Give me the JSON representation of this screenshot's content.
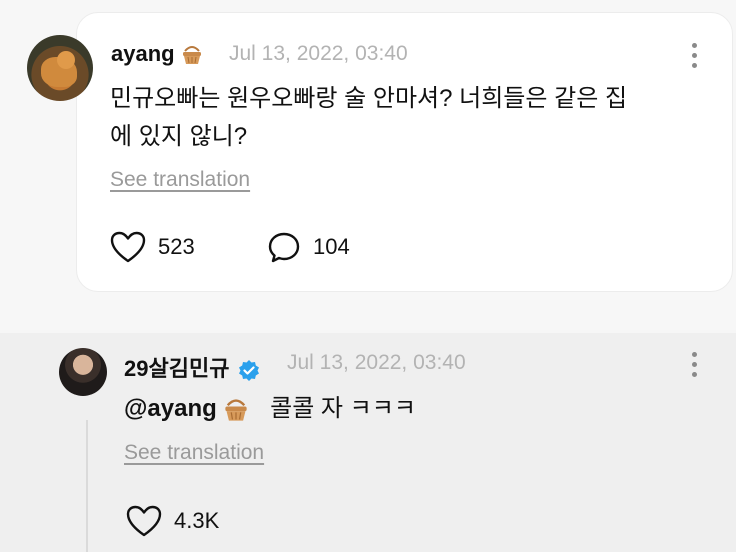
{
  "fan_comment": {
    "username": "ayang",
    "timestamp": "Jul 13, 2022, 03:40",
    "text_line1": "민규오빠는 원우오빠랑 술 안마셔? 너희들은 같은 집",
    "text_line2": "에 있지 않니?",
    "see_translation": "See translation",
    "likes": "523",
    "replies": "104"
  },
  "artist_reply": {
    "username": "29살김민규",
    "timestamp": "Jul 13, 2022, 03:40",
    "mention": "@ayang",
    "text": "콜콜 자 ㅋㅋㅋ",
    "see_translation": "See translation",
    "likes": "4.3K"
  },
  "colors": {
    "verified_badge": "#2aa0ec",
    "basket": "#c98a4b"
  }
}
